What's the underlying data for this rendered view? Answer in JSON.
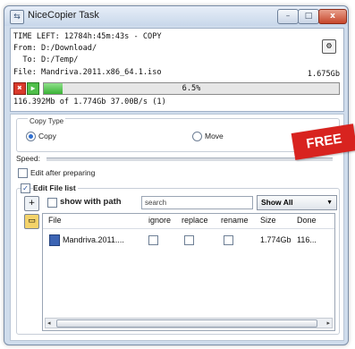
{
  "window": {
    "title": "NiceCopier Task",
    "buttons": {
      "minimize": "–",
      "maximize": "□",
      "close": "x"
    }
  },
  "info": {
    "time_left": "TIME LEFT: 12784h:45m:43s - COPY",
    "from": "From: D:/Download/",
    "to": "  To: D:/Temp/",
    "file": "File: Mandriva.2011.x86_64.1.iso",
    "file_size": "1.675Gb",
    "progress_text": "6.5%",
    "progress_fraction": 0.065,
    "stats": "116.392Mb of 1.774Gb 37.00B/s (1)"
  },
  "copy_type": {
    "legend": "Copy Type",
    "options": [
      {
        "label": "Copy",
        "selected": true
      },
      {
        "label": "Move",
        "selected": false
      }
    ]
  },
  "speed_label": "Speed:",
  "edit_after_preparing": {
    "label": "Edit after preparing",
    "checked": false
  },
  "edit_file_list": {
    "label": "Edit File list",
    "checked": true,
    "show_with_path": {
      "label": "show with path",
      "checked": false
    },
    "search_placeholder": "search",
    "filter_value": "Show All",
    "columns": [
      "File",
      "ignore",
      "replace",
      "rename",
      "Size",
      "Done"
    ],
    "rows": [
      {
        "file": "Mandriva.2011....",
        "ignore": false,
        "replace": false,
        "rename": false,
        "size": "1.774Gb",
        "done": "116..."
      }
    ]
  },
  "badge": {
    "text": "FREE",
    "color": "#d8231f"
  },
  "colors": {
    "progress": "#3ab336",
    "accent": "#2f6fd0"
  }
}
